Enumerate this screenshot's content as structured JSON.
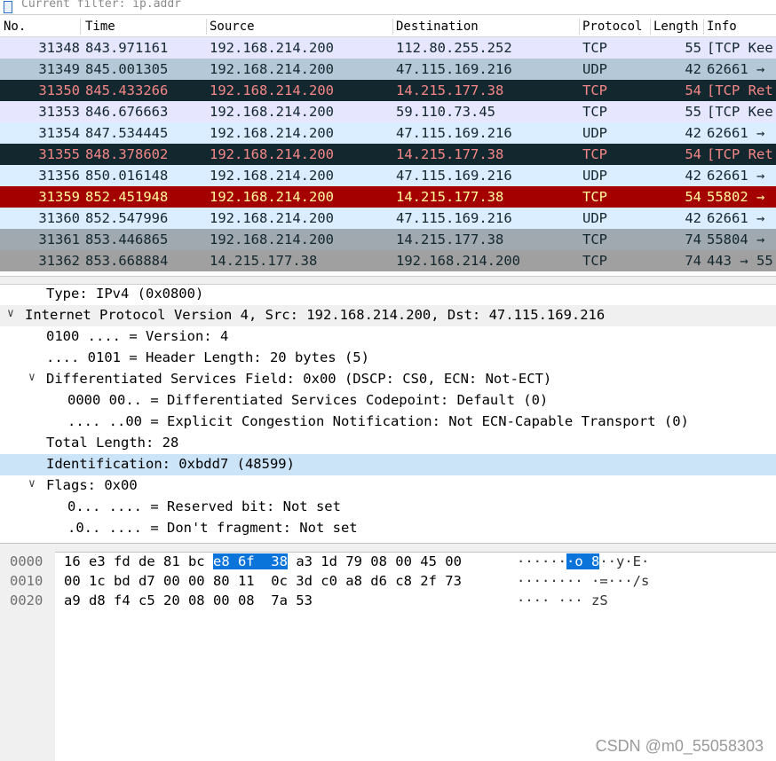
{
  "filter": {
    "placeholder": "Current filter: ip.addr"
  },
  "columns": [
    "No.",
    "Time",
    "Source",
    "Destination",
    "Protocol",
    "Length",
    "Info"
  ],
  "packets": [
    {
      "no": "31348",
      "time": "843.971161",
      "src": "192.168.214.200",
      "dst": "112.80.255.252",
      "proto": "TCP",
      "len": "55",
      "info": "[TCP Kee",
      "bg": "#e7e6ff",
      "fg": "#12272e"
    },
    {
      "no": "31349",
      "time": "845.001305",
      "src": "192.168.214.200",
      "dst": "47.115.169.216",
      "proto": "UDP",
      "len": "42",
      "info": "62661 →",
      "bg": "#b4c8d8",
      "fg": "#12272e"
    },
    {
      "no": "31350",
      "time": "845.433266",
      "src": "192.168.214.200",
      "dst": "14.215.177.38",
      "proto": "TCP",
      "len": "54",
      "info": "[TCP Ret",
      "bg": "#12272e",
      "fg": "#f78787"
    },
    {
      "no": "31353",
      "time": "846.676663",
      "src": "192.168.214.200",
      "dst": "59.110.73.45",
      "proto": "TCP",
      "len": "55",
      "info": "[TCP Kee",
      "bg": "#e7e6ff",
      "fg": "#12272e"
    },
    {
      "no": "31354",
      "time": "847.534445",
      "src": "192.168.214.200",
      "dst": "47.115.169.216",
      "proto": "UDP",
      "len": "42",
      "info": "62661 →",
      "bg": "#daeeff",
      "fg": "#12272e"
    },
    {
      "no": "31355",
      "time": "848.378602",
      "src": "192.168.214.200",
      "dst": "14.215.177.38",
      "proto": "TCP",
      "len": "54",
      "info": "[TCP Ret",
      "bg": "#12272e",
      "fg": "#f78787"
    },
    {
      "no": "31356",
      "time": "850.016148",
      "src": "192.168.214.200",
      "dst": "47.115.169.216",
      "proto": "UDP",
      "len": "42",
      "info": "62661 →",
      "bg": "#daeeff",
      "fg": "#12272e"
    },
    {
      "no": "31359",
      "time": "852.451948",
      "src": "192.168.214.200",
      "dst": "14.215.177.38",
      "proto": "TCP",
      "len": "54",
      "info": "55802 →",
      "bg": "#a40000",
      "fg": "#fffc9c"
    },
    {
      "no": "31360",
      "time": "852.547996",
      "src": "192.168.214.200",
      "dst": "47.115.169.216",
      "proto": "UDP",
      "len": "42",
      "info": "62661 →",
      "bg": "#daeeff",
      "fg": "#12272e"
    },
    {
      "no": "31361",
      "time": "853.446865",
      "src": "192.168.214.200",
      "dst": "14.215.177.38",
      "proto": "TCP",
      "len": "74",
      "info": "55804 →",
      "bg": "#a0a8b0",
      "fg": "#12272e"
    },
    {
      "no": "31362",
      "time": "853.668884",
      "src": "14.215.177.38",
      "dst": "192.168.214.200",
      "proto": "TCP",
      "len": "74",
      "info": "443 → 55",
      "bg": "#a0a0a0",
      "fg": "#12272e"
    }
  ],
  "details": [
    {
      "indent": 52,
      "arrow": "",
      "text": "Type: IPv4 (0x0800)"
    },
    {
      "indent": 28,
      "arrow": "expanded",
      "text": "Internet Protocol Version 4, Src: 192.168.214.200, Dst: 47.115.169.216",
      "hover": true
    },
    {
      "indent": 52,
      "arrow": "",
      "text": "0100 .... = Version: 4"
    },
    {
      "indent": 52,
      "arrow": "",
      "text": ".... 0101 = Header Length: 20 bytes (5)"
    },
    {
      "indent": 52,
      "arrow": "expanded",
      "text": "Differentiated Services Field: 0x00 (DSCP: CS0, ECN: Not-ECT)"
    },
    {
      "indent": 76,
      "arrow": "",
      "text": "0000 00.. = Differentiated Services Codepoint: Default (0)"
    },
    {
      "indent": 76,
      "arrow": "",
      "text": ".... ..00 = Explicit Congestion Notification: Not ECN-Capable Transport (0)"
    },
    {
      "indent": 52,
      "arrow": "",
      "text": "Total Length: 28"
    },
    {
      "indent": 52,
      "arrow": "",
      "text": "Identification: 0xbdd7 (48599)",
      "selected": true
    },
    {
      "indent": 52,
      "arrow": "expanded",
      "text": "Flags: 0x00"
    },
    {
      "indent": 76,
      "arrow": "",
      "text": "0... .... = Reserved bit: Not set"
    },
    {
      "indent": 76,
      "arrow": "",
      "text": ".0.. .... = Don't fragment: Not set"
    }
  ],
  "bytes": [
    {
      "off": "0000",
      "pre": "16 e3 fd de 81 bc ",
      "sel": "e8 6f  38",
      "post": " a3 1d 79 08 00 45 00",
      "apre": "······",
      "asel": "·o 8",
      "apost": "··y·E·"
    },
    {
      "off": "0010",
      "pre": "00 1c bd d7 00 00 80 11  0c 3d c0 a8 d6 c8 2f 73",
      "sel": "",
      "post": "",
      "apre": "········ ·=···/s",
      "asel": "",
      "apost": ""
    },
    {
      "off": "0020",
      "pre": "a9 d8 f4 c5 20 08 00 08  7a 53",
      "sel": "",
      "post": "",
      "apre": "···· ··· zS",
      "asel": "",
      "apost": ""
    }
  ],
  "watermark": "CSDN @m0_55058303",
  "icons": {
    "expanded": "chevron-down-icon",
    "bookmark": "bookmark-icon"
  }
}
